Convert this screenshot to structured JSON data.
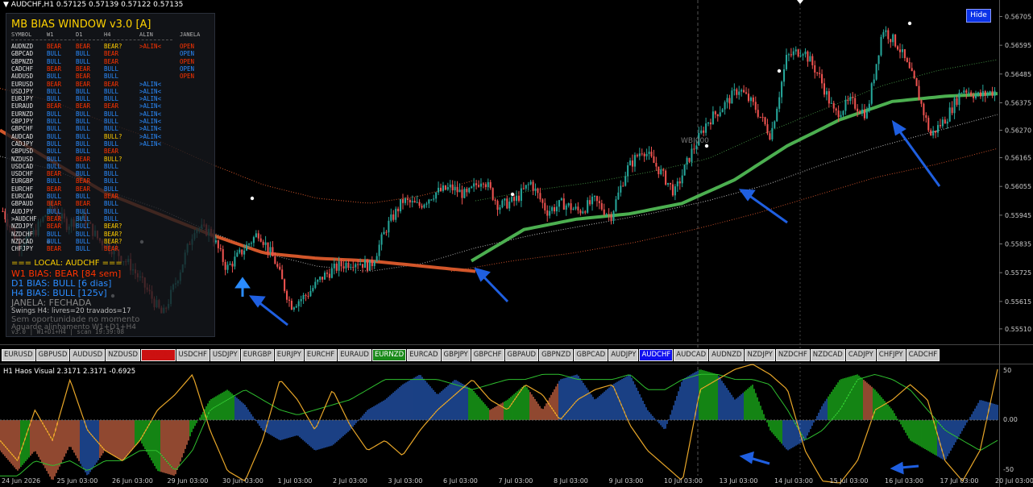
{
  "header": {
    "symbol_info": "AUDCHF,H1  0.57125 0.57139 0.57122 0.57135",
    "hide_label": "Hide"
  },
  "panel": {
    "title": "MB BIAS WINDOW v3.0 [A]",
    "headers": [
      "SYMBOL",
      "W1",
      "D1",
      "H4",
      "ALIN",
      "JANELA"
    ],
    "rows": [
      [
        "AUDNZD",
        "BEAR",
        "BEAR",
        "BEAR?",
        ">ALIN<",
        "OPEN"
      ],
      [
        "GBPCAD",
        "BULL",
        "BULL",
        "BEAR",
        "",
        "OPEN"
      ],
      [
        "GBPNZD",
        "BULL",
        "BULL",
        "BEAR",
        "",
        "OPEN"
      ],
      [
        "CADCHF",
        "BEAR",
        "BEAR",
        "BULL",
        "",
        "OPEN"
      ],
      [
        "AUDUSD",
        "BULL",
        "BEAR",
        "BULL",
        "",
        "OPEN"
      ],
      [
        "EURUSD",
        "BEAR",
        "BEAR",
        "BEAR",
        ">ALIN<",
        ""
      ],
      [
        "USDJPY",
        "BULL",
        "BULL",
        "BULL",
        ">ALIN<",
        ""
      ],
      [
        "EURJPY",
        "BULL",
        "BULL",
        "BULL",
        ">ALIN<",
        ""
      ],
      [
        "EURAUD",
        "BEAR",
        "BEAR",
        "BEAR",
        ">ALIN<",
        ""
      ],
      [
        "EURNZD",
        "BULL",
        "BULL",
        "BULL",
        ">ALIN<",
        ""
      ],
      [
        "GBPJPY",
        "BULL",
        "BULL",
        "BULL",
        ">ALIN<",
        ""
      ],
      [
        "GBPCHF",
        "BULL",
        "BULL",
        "BULL",
        ">ALIN<",
        ""
      ],
      [
        "AUDCAD",
        "BULL",
        "BULL",
        "BULL?",
        ">ALIN<",
        ""
      ],
      [
        "CADJPY",
        "BULL",
        "BULL",
        "BULL",
        ">ALIN<",
        ""
      ],
      [
        "GBPUSD",
        "BULL",
        "BULL",
        "BEAR",
        "",
        ""
      ],
      [
        "NZDUSD",
        "BULL",
        "BEAR",
        "BULL?",
        "",
        ""
      ],
      [
        "USDCAD",
        "BULL",
        "BULL",
        "BULL",
        "",
        ""
      ],
      [
        "USDCHF",
        "BEAR",
        "BULL",
        "BULL",
        "",
        ""
      ],
      [
        "EURGBP",
        "BULL",
        "BEAR",
        "BULL",
        "",
        ""
      ],
      [
        "EURCHF",
        "BEAR",
        "BEAR",
        "BULL",
        "",
        ""
      ],
      [
        "EURCAD",
        "BULL",
        "BULL",
        "BEAR",
        "",
        ""
      ],
      [
        "GBPAUD",
        "BEAR",
        "BEAR",
        "BULL",
        "",
        ""
      ],
      [
        "AUDJPY",
        "BULL",
        "BULL",
        "BULL",
        "",
        ""
      ],
      [
        ">AUDCHF",
        "BEAR",
        "BULL",
        "BULL",
        "",
        ""
      ],
      [
        "NZDJPY",
        "BEAR",
        "BULL",
        "BEAR?",
        "",
        ""
      ],
      [
        "NZDCHF",
        "BULL",
        "BULL",
        "BEAR?",
        "",
        ""
      ],
      [
        "NZDCAD",
        "BULL",
        "BULL",
        "BEAR?",
        "",
        ""
      ],
      [
        "CHFJPY",
        "BEAR",
        "BULL",
        "BEAR",
        "",
        ""
      ]
    ],
    "local_title": "=== LOCAL: AUDCHF ===",
    "w1_bias": "W1 BIAS: BEAR [84 sem]",
    "d1_bias": "D1 BIAS: BULL [6 dias]",
    "h4_bias": "H4 BIAS: BULL [125v]",
    "janela": "JANELA:  FECHADA",
    "swings": "Swings H4: livres=20  travados=17",
    "sem_op": "Sem oportunidade no momento",
    "aguarde": "Aguarde alinhamento W1+D1+H4",
    "scan": "v3.0 | W1+D1+H4 | scan 19:39:08"
  },
  "colors": {
    "bull": "#2b8cff",
    "bear": "#ff3300",
    "warn": "#ffcc00",
    "orange_ma": "#d2562a",
    "green_ma": "#4caf50",
    "up_candle": "#26a69a",
    "down_candle": "#ef5350",
    "accent_arrow": "#1f5fe0"
  },
  "buttons": [
    {
      "label": "EURUSD",
      "state": "normal"
    },
    {
      "label": "GBPUSD",
      "state": "normal"
    },
    {
      "label": "AUDUSD",
      "state": "normal"
    },
    {
      "label": "NZDUSD",
      "state": "normal"
    },
    {
      "label": "USDCAD",
      "state": "red"
    },
    {
      "label": "USDCHF",
      "state": "normal"
    },
    {
      "label": "USDJPY",
      "state": "normal"
    },
    {
      "label": "EURGBP",
      "state": "normal"
    },
    {
      "label": "EURJPY",
      "state": "normal"
    },
    {
      "label": "EURCHF",
      "state": "normal"
    },
    {
      "label": "EURAUD",
      "state": "normal"
    },
    {
      "label": "EURNZD",
      "state": "green"
    },
    {
      "label": "EURCAD",
      "state": "normal"
    },
    {
      "label": "GBPJPY",
      "state": "normal"
    },
    {
      "label": "GBPCHF",
      "state": "normal"
    },
    {
      "label": "GBPAUD",
      "state": "normal"
    },
    {
      "label": "GBPNZD",
      "state": "normal"
    },
    {
      "label": "GBPCAD",
      "state": "normal"
    },
    {
      "label": "AUDJPY",
      "state": "normal"
    },
    {
      "label": "AUDCHF",
      "state": "blue"
    },
    {
      "label": "AUDCAD",
      "state": "normal"
    },
    {
      "label": "AUDNZD",
      "state": "normal"
    },
    {
      "label": "NZDJPY",
      "state": "normal"
    },
    {
      "label": "NZDCHF",
      "state": "normal"
    },
    {
      "label": "NZDCAD",
      "state": "normal"
    },
    {
      "label": "CADJPY",
      "state": "normal"
    },
    {
      "label": "CHFJPY",
      "state": "normal"
    },
    {
      "label": "CADCHF",
      "state": "normal"
    }
  ],
  "indicator": {
    "title": "H1 Haos Visual 2.3171 2.3171 -0.6925",
    "levels": [
      "50",
      "0.00",
      "-50"
    ]
  },
  "watermark": "WBI000",
  "chart_data": {
    "type": "candlestick",
    "price_axis": [
      "0.56705",
      "0.56595",
      "0.56485",
      "0.56375",
      "0.56270",
      "0.56165",
      "0.56055",
      "0.55945",
      "0.55835",
      "0.55725",
      "0.55615",
      "0.55510"
    ],
    "ylim": [
      0.55485,
      0.56725
    ],
    "time_axis": [
      "24 Jun 2026",
      "25 Jun 03:00",
      "26 Jun 03:00",
      "29 Jun 03:00",
      "30 Jun 03:00",
      "1 Jul 03:00",
      "2 Jul 03:00",
      "3 Jul 03:00",
      "6 Jul 03:00",
      "7 Jul 03:00",
      "8 Jul 03:00",
      "9 Jul 03:00",
      "10 Jul 03:00",
      "13 Jul 03:00",
      "14 Jul 03:00",
      "15 Jul 03:00",
      "16 Jul 03:00",
      "17 Jul 03:00",
      "20 Jul 03:00"
    ],
    "price_path": [
      0.5596,
      0.5583,
      0.5588,
      0.5598,
      0.5591,
      0.5594,
      0.5585,
      0.5581,
      0.5575,
      0.5566,
      0.5556,
      0.5572,
      0.559,
      0.5588,
      0.5574,
      0.5581,
      0.5588,
      0.5577,
      0.556,
      0.5564,
      0.5571,
      0.5575,
      0.5577,
      0.5575,
      0.559,
      0.56,
      0.5598,
      0.5603,
      0.5605,
      0.5602,
      0.5609,
      0.5598,
      0.56,
      0.5607,
      0.5596,
      0.5599,
      0.5596,
      0.56,
      0.5594,
      0.5612,
      0.562,
      0.5612,
      0.5603,
      0.5618,
      0.563,
      0.5636,
      0.5643,
      0.5636,
      0.5625,
      0.5655,
      0.5658,
      0.5648,
      0.5633,
      0.5638,
      0.5633,
      0.5666,
      0.5659,
      0.5645,
      0.5625,
      0.5632,
      0.5643,
      0.564,
      0.5642
    ],
    "orange_ma": [
      0.5627,
      0.5615,
      0.5603,
      0.5595,
      0.5587,
      0.558,
      0.5578,
      0.5577,
      0.5575,
      0.5573
    ],
    "green_ma": [
      0.5577,
      0.5589,
      0.5593,
      0.5595,
      0.5599,
      0.5608,
      0.5621,
      0.5631,
      0.5638,
      0.564,
      0.5641
    ],
    "oscillator_levels": [
      50,
      0,
      -50
    ]
  }
}
